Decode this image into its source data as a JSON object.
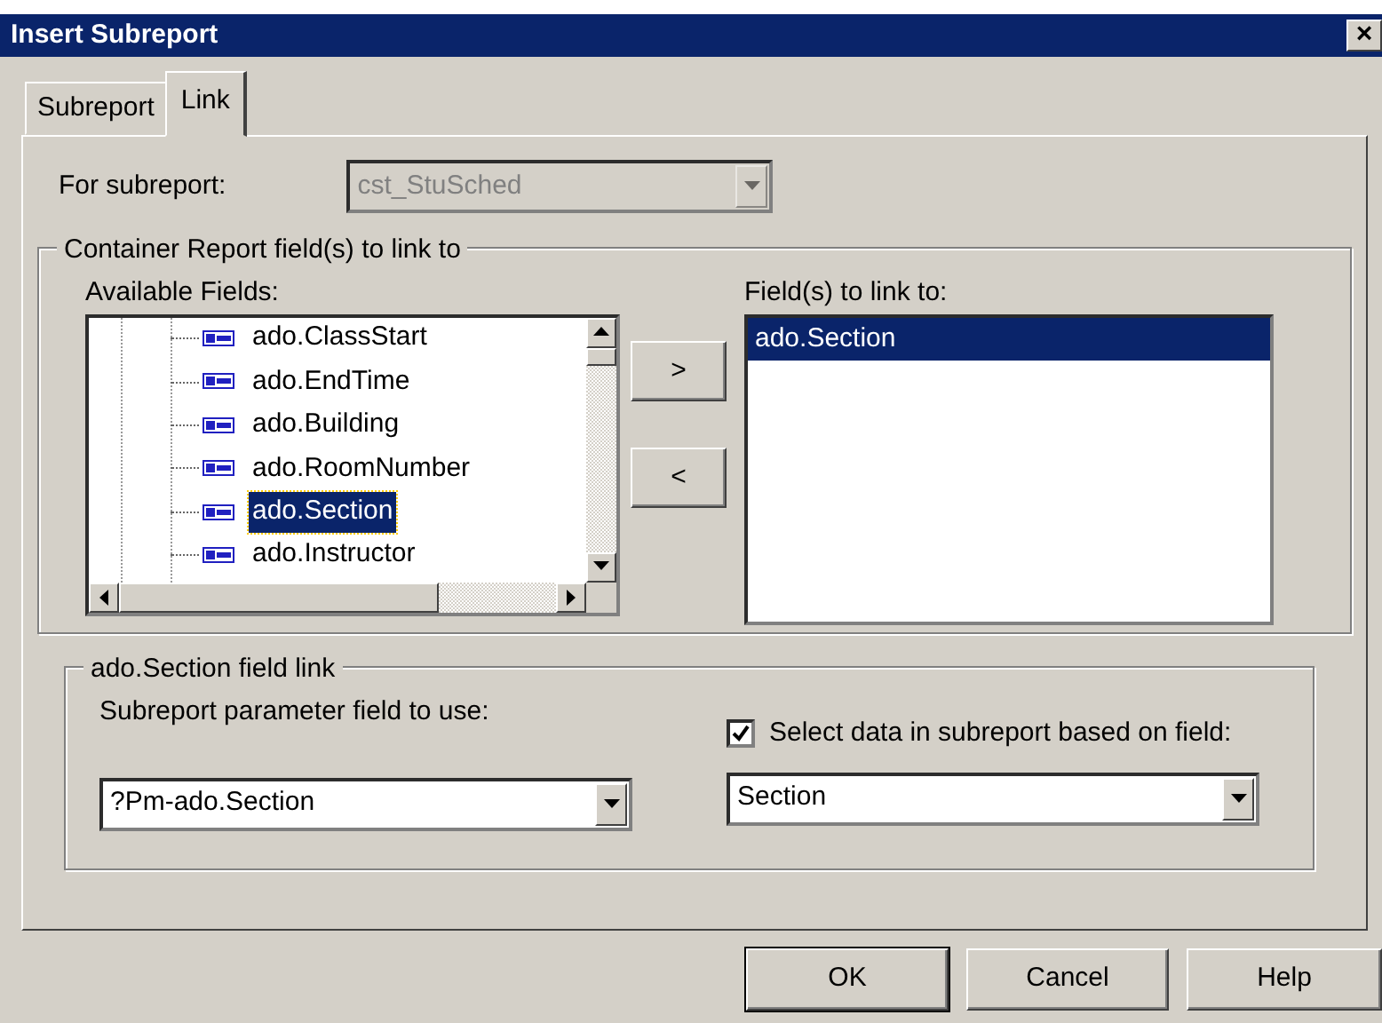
{
  "window": {
    "title": "Insert Subreport",
    "close": "×"
  },
  "tabs": [
    {
      "label": "Subreport",
      "selected": false
    },
    {
      "label": "Link",
      "selected": true
    }
  ],
  "for_subreport": {
    "label": "For subreport:",
    "value": "cst_StuSched",
    "disabled": true
  },
  "container_group": {
    "title": "Container Report field(s) to link to",
    "available": {
      "label": "Available Fields:",
      "items": [
        {
          "label": "ado.ClassStart",
          "selected": false
        },
        {
          "label": "ado.EndTime",
          "selected": false
        },
        {
          "label": "ado.Building",
          "selected": false
        },
        {
          "label": "ado.RoomNumber",
          "selected": false
        },
        {
          "label": "ado.Section",
          "selected": true
        },
        {
          "label": "ado.Instructor",
          "selected": false
        }
      ]
    },
    "move_buttons": [
      ">",
      "<"
    ],
    "linked": {
      "label": "Field(s) to link to:",
      "items": [
        {
          "label": "ado.Section",
          "selected": true
        }
      ]
    }
  },
  "link_group": {
    "title": "ado.Section field link",
    "param_label": "Subreport parameter field to use:",
    "param_value": "?Pm-ado.Section",
    "select_data": {
      "label": "Select data in subreport based on field:",
      "checked": true
    },
    "field_value": "Section"
  },
  "buttons": [
    {
      "label": "OK",
      "default": true
    },
    {
      "label": "Cancel",
      "default": false
    },
    {
      "label": "Help",
      "default": false
    }
  ]
}
